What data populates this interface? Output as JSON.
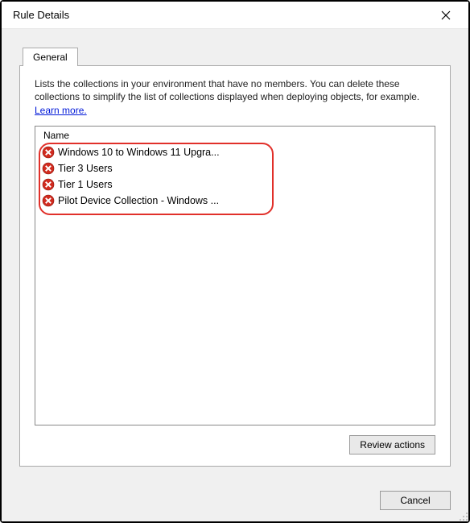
{
  "window": {
    "title": "Rule Details",
    "close_icon": "close"
  },
  "tabs": [
    {
      "label": "General",
      "active": true
    }
  ],
  "general": {
    "description": "Lists the collections in your environment that have no members. You can delete these collections to simplify the list of collections displayed when deploying objects, for example.",
    "learn_more": "Learn more.",
    "column_header": "Name",
    "items": [
      {
        "label": "Windows 10 to Windows 11 Upgra..."
      },
      {
        "label": "Tier 3 Users"
      },
      {
        "label": "Tier 1 Users"
      },
      {
        "label": "Pilot Device Collection - Windows ..."
      }
    ],
    "review_button": "Review actions"
  },
  "footer": {
    "cancel": "Cancel"
  }
}
